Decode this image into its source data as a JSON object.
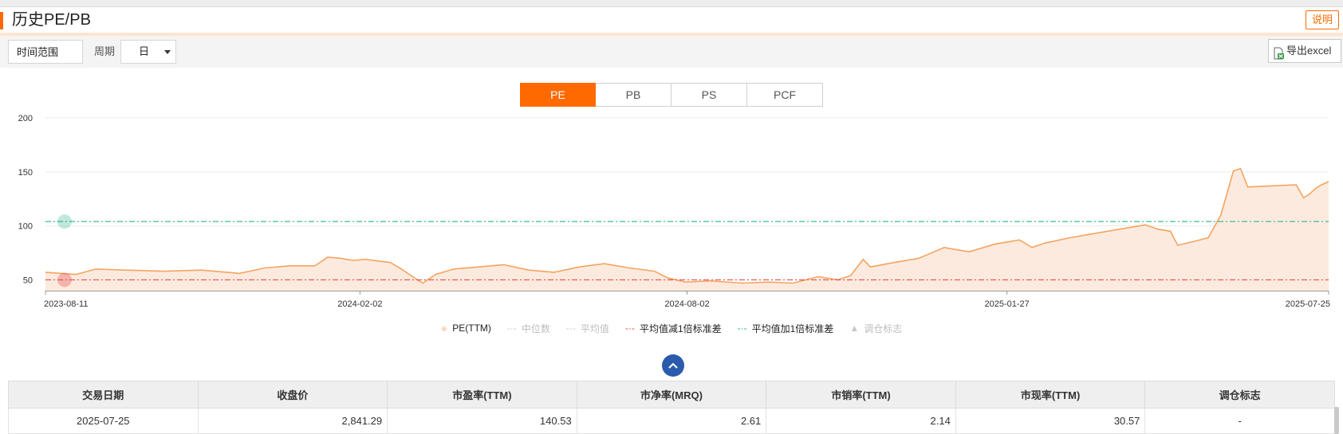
{
  "header": {
    "title": "历史PE/PB",
    "explain_label": "说明"
  },
  "toolbar": {
    "time_range_label": "时间范围",
    "period_label": "周期",
    "period_value": "日",
    "export_label": "导出excel"
  },
  "tabs": [
    {
      "label": "PE",
      "active": true
    },
    {
      "label": "PB",
      "active": false
    },
    {
      "label": "PS",
      "active": false
    },
    {
      "label": "PCF",
      "active": false
    }
  ],
  "colors": {
    "accent": "#ff6a00",
    "pe_line": "#f4a460",
    "pe_fill": "#fde6d8",
    "minus_std": "#e05050",
    "plus_std": "#2db38c",
    "button_blue": "#2a5bad"
  },
  "legend": [
    {
      "label": "PE(TTM)",
      "active": true,
      "marker": "circle",
      "color": "#fcd7bf"
    },
    {
      "label": "中位数",
      "active": false,
      "marker": "dash",
      "color": "#c8c8c8"
    },
    {
      "label": "平均值",
      "active": false,
      "marker": "dash",
      "color": "#c8c8c8"
    },
    {
      "label": "平均值减1倍标准差",
      "active": true,
      "marker": "dash",
      "color": "#e05050"
    },
    {
      "label": "平均值加1倍标准差",
      "active": true,
      "marker": "dash",
      "color": "#2db38c"
    },
    {
      "label": "调仓标志",
      "active": false,
      "marker": "triangle",
      "color": "#c8c8c8"
    }
  ],
  "chart_data": {
    "type": "area",
    "ylim": [
      40,
      200
    ],
    "yticks": [
      "50",
      "100",
      "150",
      "200"
    ],
    "xticks": [
      "2023-08-11",
      "2024-02-02",
      "2024-08-02",
      "2025-01-27",
      "2025-07-25"
    ],
    "x_range": [
      "2023-08-11",
      "2025-07-25"
    ],
    "grid": true,
    "series": [
      {
        "name": "PE(TTM)",
        "points": [
          [
            "2023-08-11",
            57
          ],
          [
            "2023-08-28",
            55
          ],
          [
            "2023-09-08",
            60
          ],
          [
            "2023-09-25",
            59
          ],
          [
            "2023-10-16",
            58
          ],
          [
            "2023-11-06",
            59
          ],
          [
            "2023-11-27",
            56
          ],
          [
            "2023-12-11",
            61
          ],
          [
            "2023-12-25",
            63
          ],
          [
            "2024-01-08",
            63
          ],
          [
            "2024-01-15",
            71
          ],
          [
            "2024-01-22",
            70
          ],
          [
            "2024-01-29",
            68
          ],
          [
            "2024-02-05",
            69
          ],
          [
            "2024-02-19",
            66
          ],
          [
            "2024-02-26",
            59
          ],
          [
            "2024-03-04",
            51
          ],
          [
            "2024-03-08",
            47
          ],
          [
            "2024-03-15",
            55
          ],
          [
            "2024-03-25",
            60
          ],
          [
            "2024-04-08",
            62
          ],
          [
            "2024-04-22",
            64
          ],
          [
            "2024-05-06",
            59
          ],
          [
            "2024-05-20",
            57
          ],
          [
            "2024-06-03",
            62
          ],
          [
            "2024-06-17",
            65
          ],
          [
            "2024-07-01",
            61
          ],
          [
            "2024-07-15",
            58
          ],
          [
            "2024-07-22",
            52
          ],
          [
            "2024-08-01",
            48
          ],
          [
            "2024-08-15",
            49
          ],
          [
            "2024-09-02",
            47
          ],
          [
            "2024-09-16",
            48
          ],
          [
            "2024-09-30",
            47
          ],
          [
            "2024-10-14",
            53
          ],
          [
            "2024-10-25",
            50
          ],
          [
            "2024-11-01",
            54
          ],
          [
            "2024-11-08",
            69
          ],
          [
            "2024-11-12",
            62
          ],
          [
            "2024-11-25",
            66
          ],
          [
            "2024-12-09",
            70
          ],
          [
            "2024-12-23",
            80
          ],
          [
            "2025-01-06",
            76
          ],
          [
            "2025-01-20",
            83
          ],
          [
            "2025-02-03",
            87
          ],
          [
            "2025-02-10",
            80
          ],
          [
            "2025-02-17",
            84
          ],
          [
            "2025-03-03",
            89
          ],
          [
            "2025-03-17",
            93
          ],
          [
            "2025-03-31",
            97
          ],
          [
            "2025-04-14",
            101
          ],
          [
            "2025-04-21",
            97
          ],
          [
            "2025-04-28",
            95
          ],
          [
            "2025-05-02",
            82
          ],
          [
            "2025-05-12",
            86
          ],
          [
            "2025-05-19",
            89
          ],
          [
            "2025-05-26",
            110
          ],
          [
            "2025-06-02",
            151
          ],
          [
            "2025-06-06",
            153
          ],
          [
            "2025-06-10",
            136
          ],
          [
            "2025-06-23",
            137
          ],
          [
            "2025-07-07",
            138
          ],
          [
            "2025-07-11",
            126
          ],
          [
            "2025-07-14",
            129
          ],
          [
            "2025-07-18",
            135
          ],
          [
            "2025-07-21",
            138
          ],
          [
            "2025-07-25",
            141
          ]
        ]
      },
      {
        "name": "平均值减1倍标准差",
        "value": 50,
        "style": "dashdot"
      },
      {
        "name": "平均值加1倍标准差",
        "value": 104,
        "style": "dashdot"
      }
    ]
  },
  "table": {
    "headers": [
      "交易日期",
      "收盘价",
      "市盈率(TTM)",
      "市净率(MRQ)",
      "市销率(TTM)",
      "市现率(TTM)",
      "调仓标志"
    ],
    "rows": [
      [
        "2025-07-25",
        "2,841.29",
        "140.53",
        "2.61",
        "2.14",
        "30.57",
        "-"
      ]
    ]
  }
}
